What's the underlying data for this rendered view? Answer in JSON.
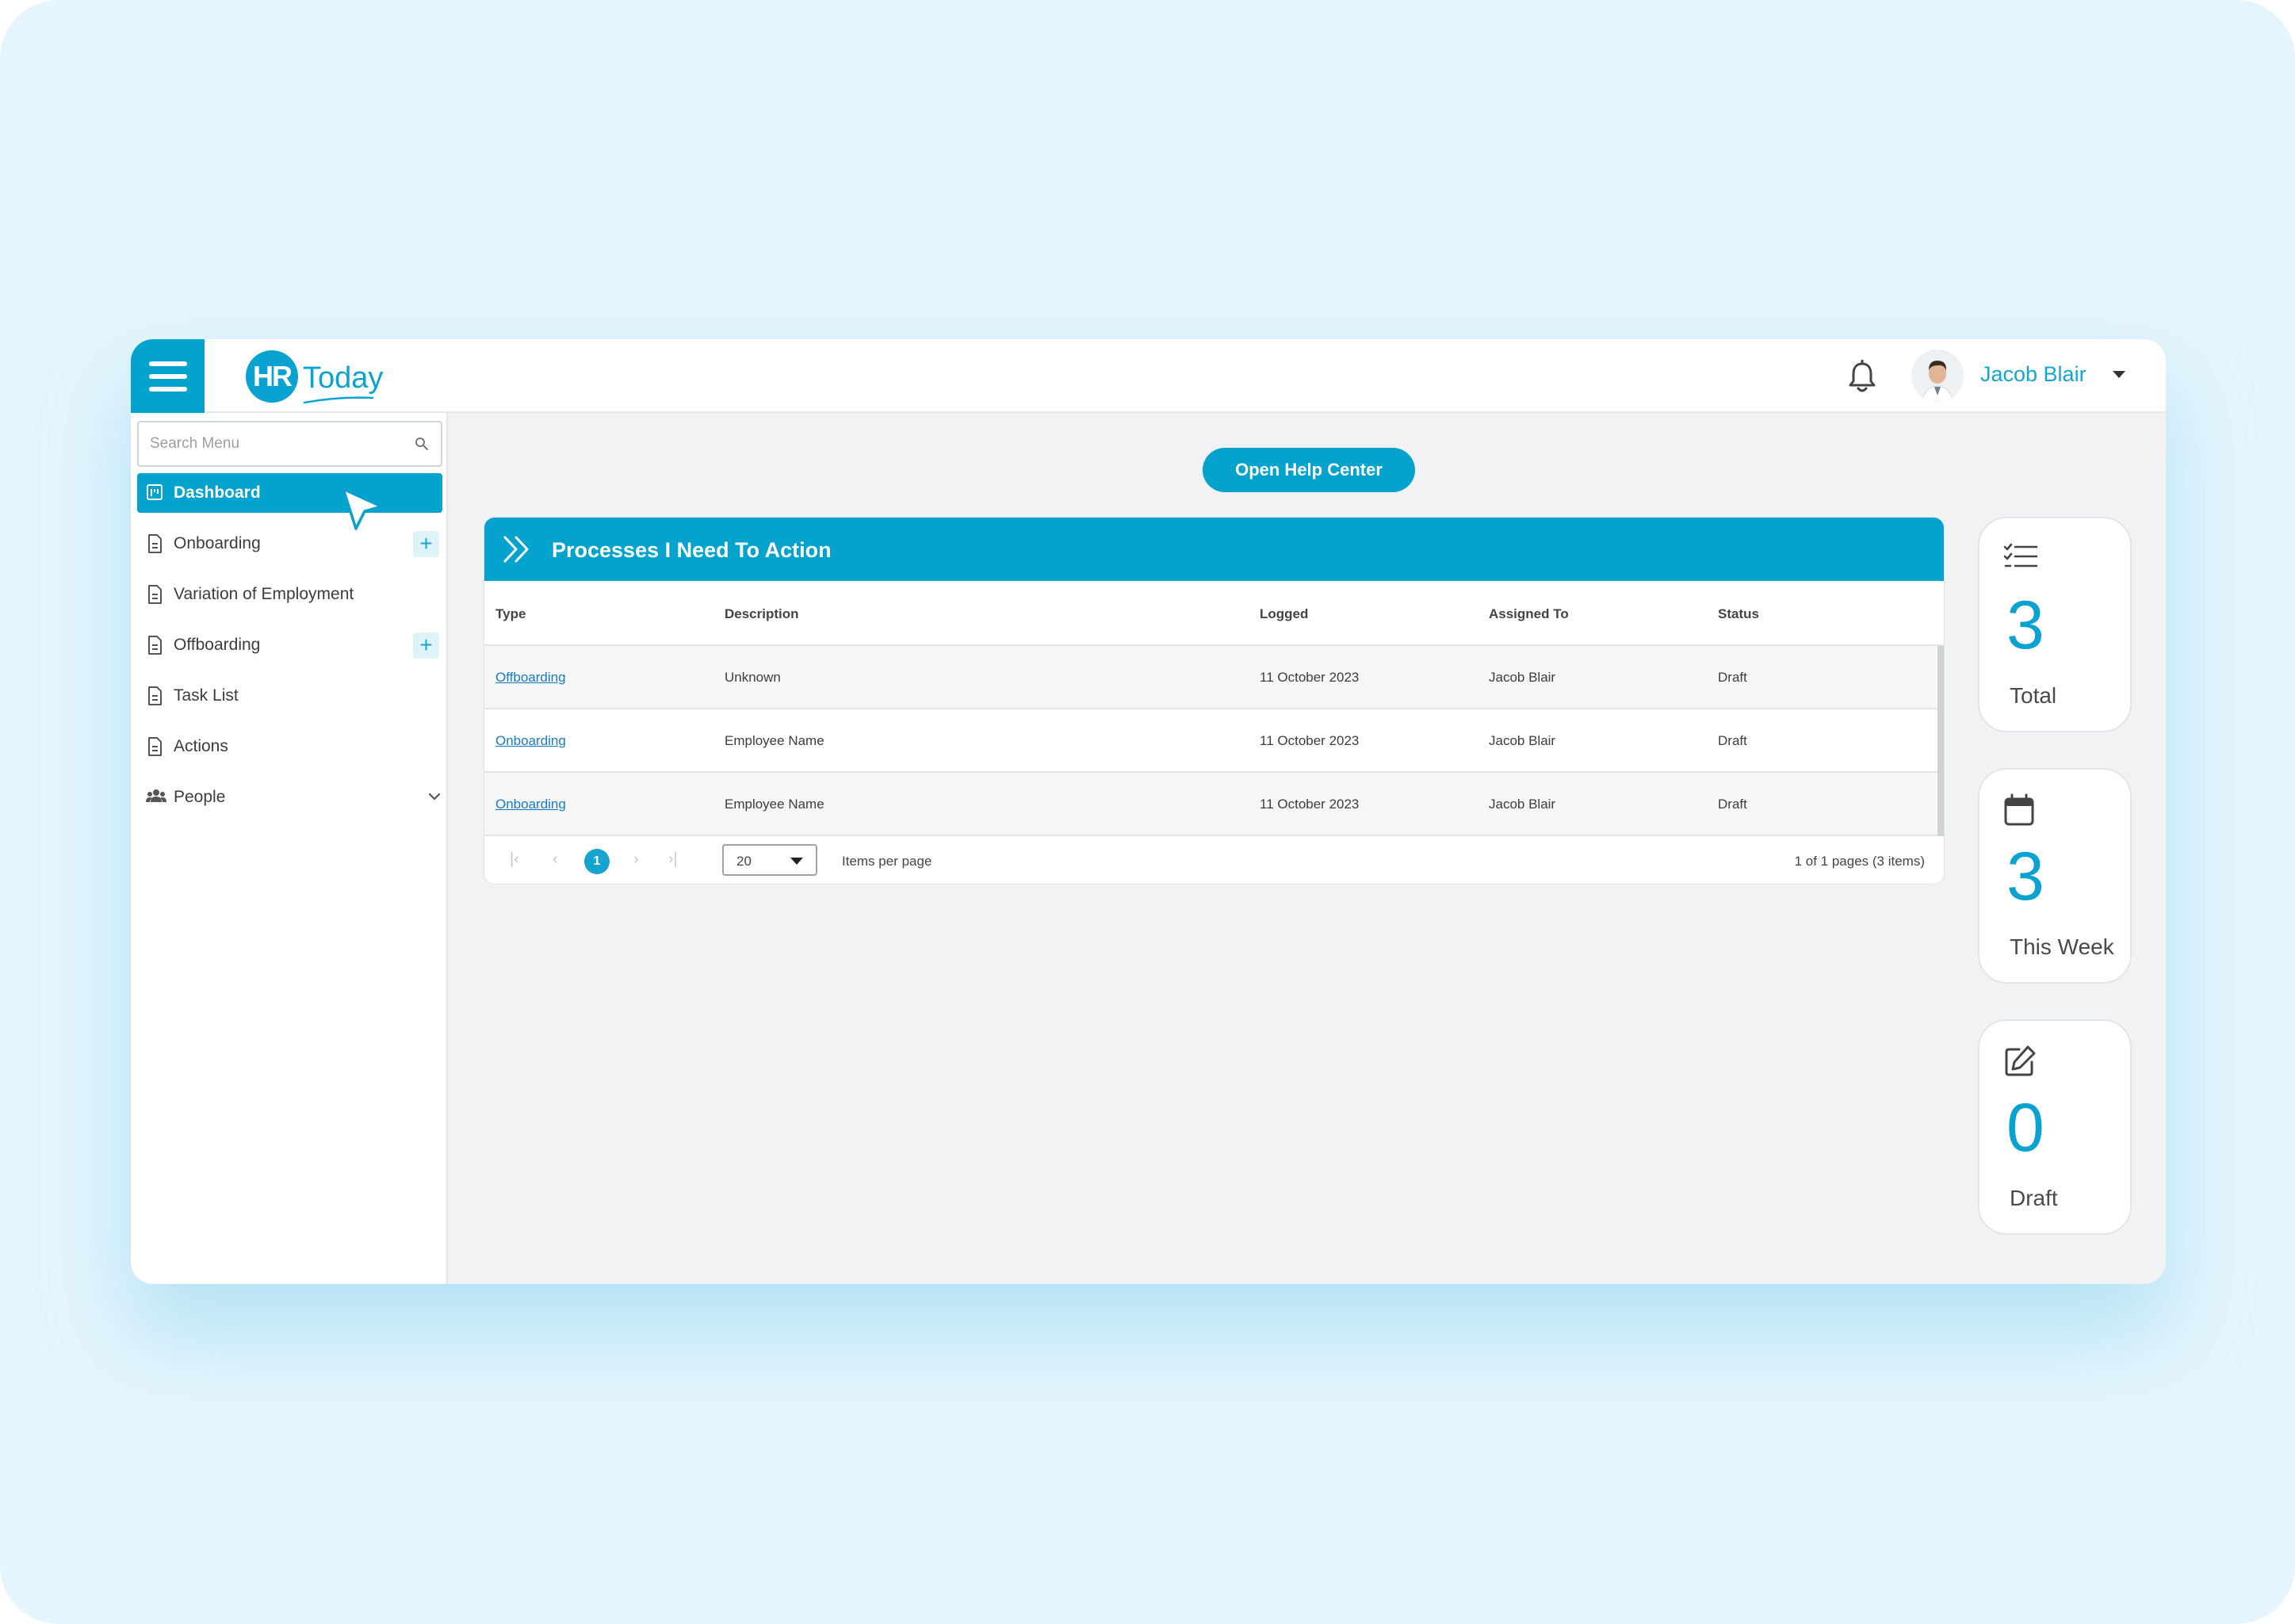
{
  "header": {
    "logo_letters": "HR",
    "logo_word": "Today",
    "user_name": "Jacob Blair"
  },
  "sidebar": {
    "search_placeholder": "Search Menu",
    "items": [
      {
        "label": "Dashboard",
        "active": true
      },
      {
        "label": "Onboarding",
        "has_add": true
      },
      {
        "label": "Variation of Employment"
      },
      {
        "label": "Offboarding",
        "has_add": true
      },
      {
        "label": "Task List"
      },
      {
        "label": "Actions"
      },
      {
        "label": "People",
        "expandable": true
      }
    ]
  },
  "main": {
    "help_button": "Open Help Center",
    "panel_title": "Processes I Need To Action",
    "columns": [
      "Type",
      "Description",
      "Logged",
      "Assigned To",
      "Status"
    ],
    "rows": [
      {
        "type": "Offboarding",
        "description": "Unknown",
        "logged": "11 October 2023",
        "assigned_to": "Jacob Blair",
        "status": "Draft"
      },
      {
        "type": "Onboarding",
        "description": "Employee Name",
        "logged": "11 October 2023",
        "assigned_to": "Jacob Blair",
        "status": "Draft"
      },
      {
        "type": "Onboarding",
        "description": "Employee Name",
        "logged": "11 October 2023",
        "assigned_to": "Jacob Blair",
        "status": "Draft"
      }
    ],
    "pager": {
      "current_page": "1",
      "per_page": "20",
      "per_page_label": "Items per page",
      "info": "1 of 1 pages (3 items)"
    }
  },
  "stats": [
    {
      "value": "3",
      "label": "Total",
      "icon": "checklist-icon"
    },
    {
      "value": "3",
      "label": "This Week",
      "icon": "calendar-icon"
    },
    {
      "value": "0",
      "label": "Draft",
      "icon": "edit-icon"
    }
  ],
  "colors": {
    "accent": "#03a3ce",
    "background": "#e4f5fd",
    "link": "#1a7bc5"
  }
}
